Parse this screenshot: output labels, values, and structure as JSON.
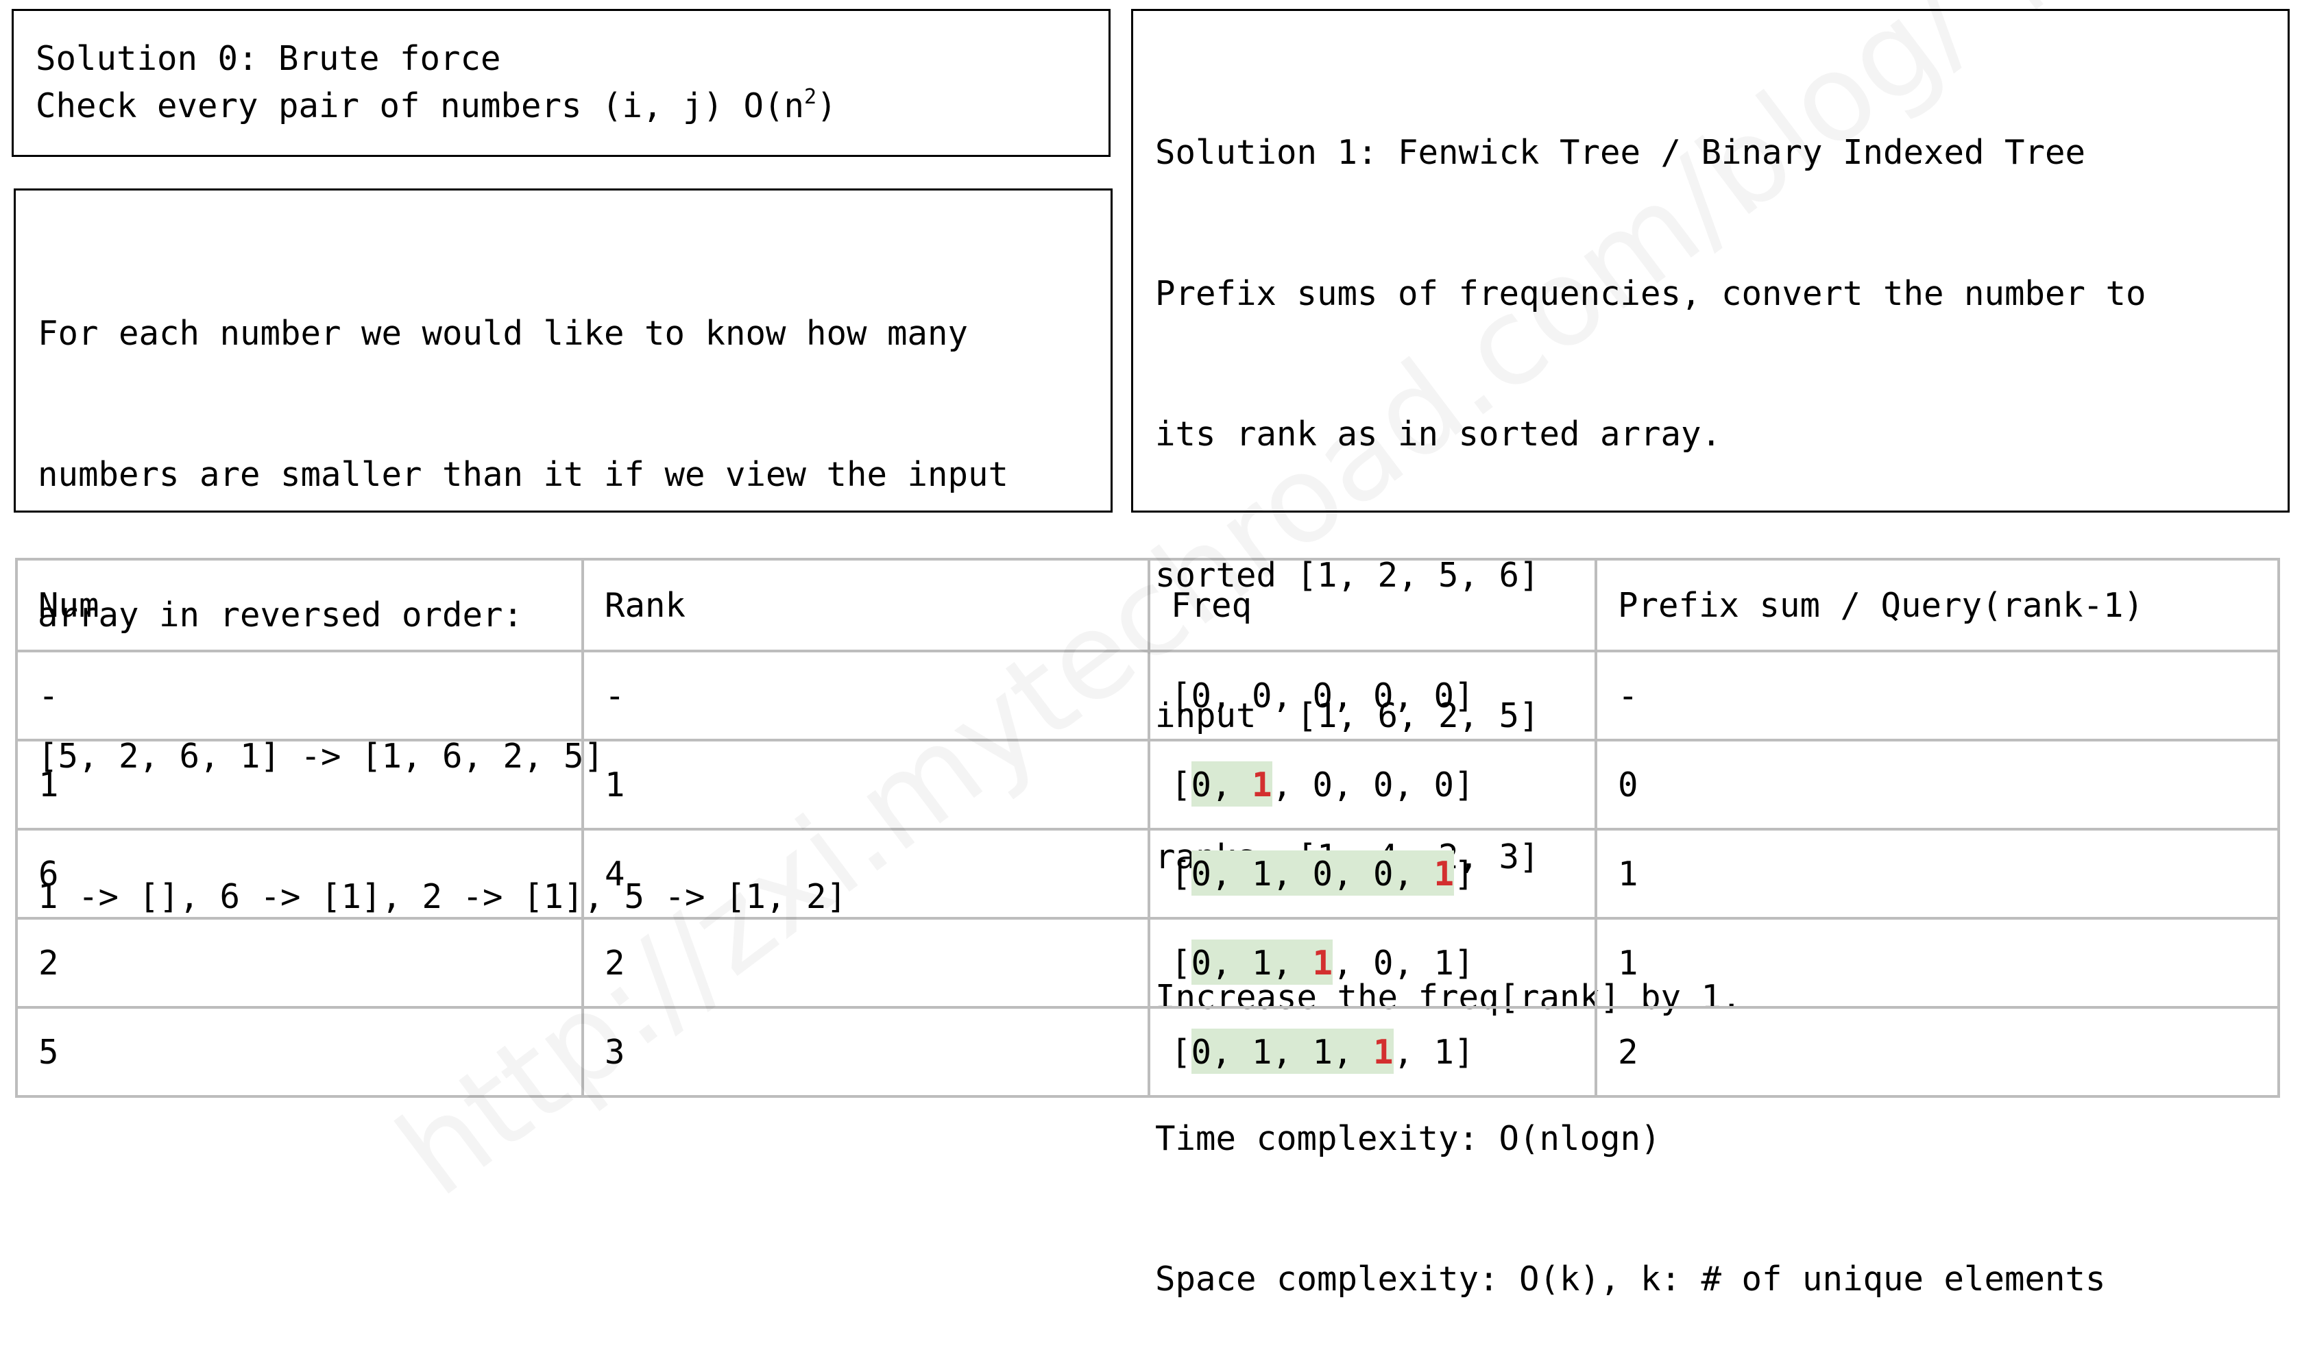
{
  "solution0": {
    "line1": "Solution 0: Brute force",
    "line2_prefix": "Check every pair of numbers (i, j) O(n",
    "line2_sup": "2",
    "line2_suffix": ")"
  },
  "description": {
    "lines": [
      "For each number we would like to know how many",
      "numbers are smaller than it if we view the input",
      "array in reversed order:",
      "[5, 2, 6, 1] -> [1, 6, 2, 5]",
      "1 -> [], 6 -> [1], 2 -> [1], 5 -> [1, 2]"
    ]
  },
  "solution1": {
    "lines": [
      "Solution 1: Fenwick Tree / Binary Indexed Tree",
      "Prefix sums of frequencies, convert the number to",
      "its rank as in sorted array.",
      "sorted [1, 2, 5, 6]",
      "input  [1, 6, 2, 5]",
      "ranks  [1, 4, 2, 3]",
      "Increase the freq[rank] by 1.",
      "Time complexity: O(nlogn)",
      "Space complexity: O(k), k: # of unique elements"
    ]
  },
  "table": {
    "headers": [
      "Num",
      "Rank",
      "Freq",
      "Prefix sum / Query(rank-1)"
    ],
    "rows": [
      {
        "num": "-",
        "rank": "-",
        "freq_pre": "[0, 0, 0, 0, 0]",
        "freq_red": "",
        "freq_post": "",
        "prefix": "-",
        "highlight_fraction": 0
      },
      {
        "num": "1",
        "rank": "1",
        "freq_pre": "[0, ",
        "freq_red": "1",
        "freq_post": ", 0, 0, 0]",
        "prefix": "0",
        "highlight_fraction": 1
      },
      {
        "num": "6",
        "rank": "4",
        "freq_pre": "[0, 1, 0, 0, ",
        "freq_red": "1",
        "freq_post": "]",
        "prefix": "1",
        "highlight_fraction": 4
      },
      {
        "num": "2",
        "rank": "2",
        "freq_pre": "[0, 1, ",
        "freq_red": "1",
        "freq_post": ", 0, 1]",
        "prefix": "1",
        "highlight_fraction": 2
      },
      {
        "num": "5",
        "rank": "3",
        "freq_pre": "[0, 1, 1, ",
        "freq_red": "1",
        "freq_post": ", 1]",
        "prefix": "2",
        "highlight_fraction": 3
      }
    ]
  },
  "watermark": "http://zxi.mytechroad.com/blog/  花花酱 LeetCode",
  "colors": {
    "highlight": "#d9ead3",
    "red": "#d32f2f",
    "grid": "#bdbdbd"
  }
}
